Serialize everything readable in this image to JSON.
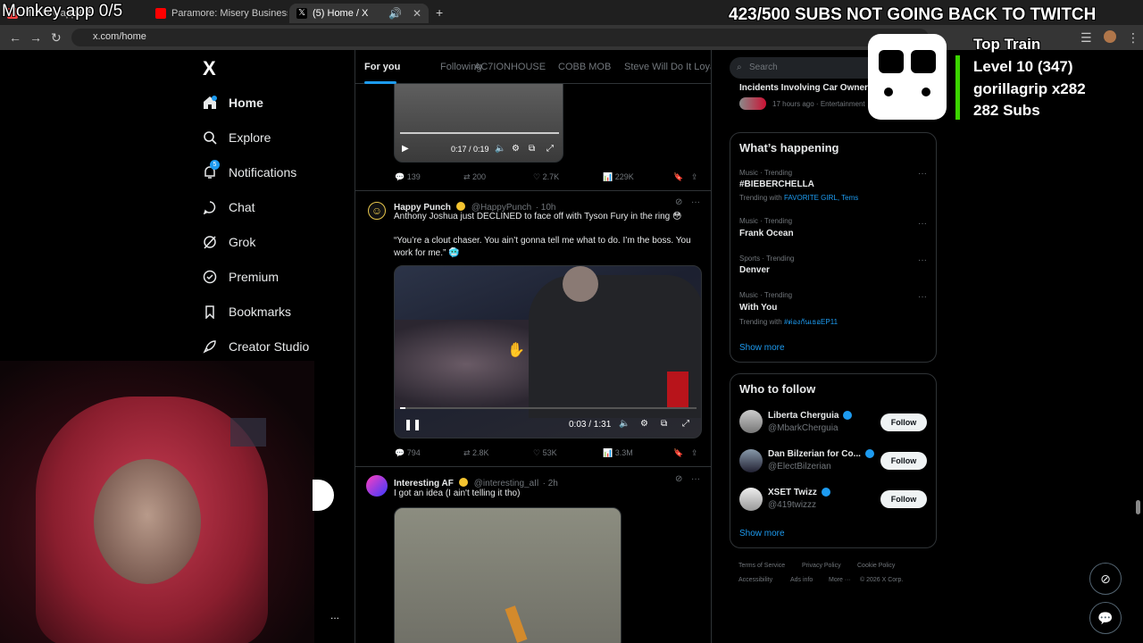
{
  "overlay": {
    "monkey_app": "Monkey app 0/5",
    "subs_goal": "423/500 SUBS NOT GOING BACK TO TWITCH",
    "train_title": "Top Train",
    "train_level": "Level 10  (347)",
    "train_user": "gorillagrip x282",
    "train_subs": "282 Subs"
  },
  "browser": {
    "tabs": [
      {
        "label": "Monkey app 0/5",
        "favicon_color": "#ff4444"
      },
      {
        "label": "Paramore: Misery Business [OFF",
        "favicon_color": "#ff0000"
      },
      {
        "label": "(5) Home / X",
        "favicon_color": "#ffffff"
      }
    ],
    "new_tab": "+",
    "url": "x.com/home"
  },
  "nav": {
    "logo": "X",
    "items": [
      {
        "label": "Home",
        "icon": "home-icon"
      },
      {
        "label": "Explore",
        "icon": "search-icon"
      },
      {
        "label": "Notifications",
        "icon": "bell-icon",
        "badge": "5"
      },
      {
        "label": "Chat",
        "icon": "chat-icon"
      },
      {
        "label": "Grok",
        "icon": "grok-icon"
      },
      {
        "label": "Premium",
        "icon": "premium-icon"
      },
      {
        "label": "Bookmarks",
        "icon": "bookmark-icon"
      },
      {
        "label": "Creator Studio",
        "icon": "rocket-icon"
      }
    ],
    "more": "..."
  },
  "feed": {
    "tabs": [
      "For you",
      "Following",
      "AC7IONHOUSE",
      "COBB MOB",
      "Steve Will Do It Loyal"
    ],
    "tweets": [
      {
        "video": {
          "time": "0:17 / 0:19"
        },
        "replies": "139",
        "reposts": "200",
        "likes": "2.7K",
        "views": "229K"
      },
      {
        "name": "Happy Punch",
        "handle": "@HappyPunch",
        "time": "· 10h",
        "text1": "Anthony Joshua just DECLINED to face off with Tyson Fury in the ring 😳",
        "text2": "“You’re a clout chaser. You ain’t gonna tell me what to do. I’m the boss. You work for me.” 🥶",
        "video": {
          "time": "0:03 / 1:31"
        },
        "replies": "794",
        "reposts": "2.8K",
        "likes": "53K",
        "views": "3.3M"
      },
      {
        "name": "Interesting AF",
        "handle": "@interesting_aIl",
        "time": "· 2h",
        "text1": "I got an idea (I ain't telling it tho)"
      }
    ]
  },
  "right": {
    "search_placeholder": "Search",
    "top_item": {
      "title": "Incidents Involving Car Owner",
      "meta": "17 hours ago · Entertainment"
    },
    "happening": {
      "title": "What’s happening",
      "trends": [
        {
          "meta": "Music · Trending",
          "name": "#BIEBERCHELLA",
          "with_label": "Trending with",
          "with": "FAVORITE GIRL, Tems"
        },
        {
          "meta": "Music · Trending",
          "name": "Frank Ocean"
        },
        {
          "meta": "Sports · Trending",
          "name": "Denver"
        },
        {
          "meta": "Music · Trending",
          "name": "With You",
          "with_label": "Trending with",
          "with": "#ต่องกันเธอEP11"
        }
      ],
      "show_more": "Show more"
    },
    "who_to_follow": {
      "title": "Who to follow",
      "accounts": [
        {
          "name": "Liberta Cherguia",
          "handle": "@MbarkCherguia",
          "button": "Follow"
        },
        {
          "name": "Dan Bilzerian for Co...",
          "handle": "@ElectBilzerian",
          "button": "Follow"
        },
        {
          "name": "XSET Twizz",
          "handle": "@419twizzz",
          "button": "Follow"
        }
      ],
      "show_more": "Show more"
    },
    "footer": [
      "Terms of Service",
      "Privacy Policy",
      "Cookie Policy",
      "Accessibility",
      "Ads info",
      "More ···",
      "© 2026 X Corp."
    ]
  }
}
